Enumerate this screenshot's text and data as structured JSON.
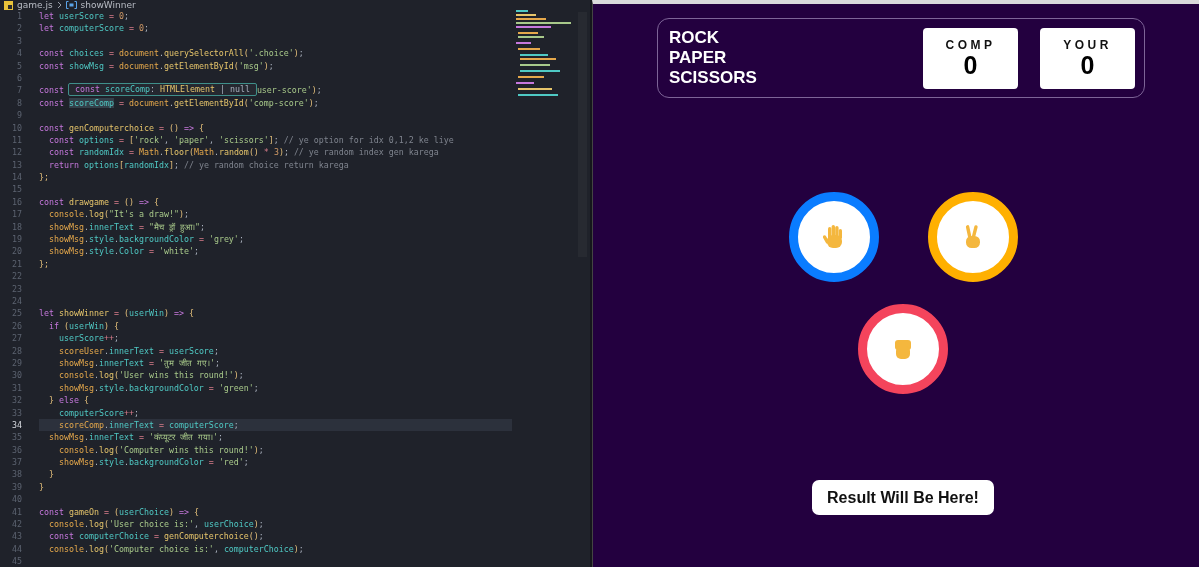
{
  "editor": {
    "breadcrumb": {
      "file": "game.js",
      "symbol": "showWinner"
    },
    "lines": [
      {
        "number": "1",
        "current": false,
        "tokens": [
          {
            "kind": "keyword",
            "text": "let "
          },
          {
            "kind": "variable",
            "text": "userScore"
          },
          {
            "kind": "operator",
            "text": " = "
          },
          {
            "kind": "number",
            "text": "0"
          },
          {
            "kind": "punct",
            "text": ";"
          }
        ]
      },
      {
        "number": "2",
        "current": false,
        "tokens": [
          {
            "kind": "keyword",
            "text": "let "
          },
          {
            "kind": "variable",
            "text": "computerScore"
          },
          {
            "kind": "operator",
            "text": " = "
          },
          {
            "kind": "number",
            "text": "0"
          },
          {
            "kind": "punct",
            "text": ";"
          }
        ]
      },
      {
        "number": "3",
        "current": false
      },
      {
        "number": "4",
        "current": false,
        "tokens": [
          {
            "kind": "keyword",
            "text": "const "
          },
          {
            "kind": "variable",
            "text": "choices"
          },
          {
            "kind": "operator",
            "text": " = "
          },
          {
            "kind": "object",
            "text": "document"
          },
          {
            "kind": "punct",
            "text": "."
          },
          {
            "kind": "function",
            "text": "querySelectorAll"
          },
          {
            "kind": "bracket",
            "text": "("
          },
          {
            "kind": "string",
            "text": "'.choice'"
          },
          {
            "kind": "bracket",
            "text": ")"
          },
          {
            "kind": "punct",
            "text": ";"
          }
        ]
      },
      {
        "number": "5",
        "current": false,
        "tokens": [
          {
            "kind": "keyword",
            "text": "const "
          },
          {
            "kind": "variable",
            "text": "showMsg"
          },
          {
            "kind": "operator",
            "text": " = "
          },
          {
            "kind": "object",
            "text": "document"
          },
          {
            "kind": "punct",
            "text": "."
          },
          {
            "kind": "function",
            "text": "getElementById"
          },
          {
            "kind": "bracket",
            "text": "("
          },
          {
            "kind": "string",
            "text": "'msg'"
          },
          {
            "kind": "bracket",
            "text": ")"
          },
          {
            "kind": "punct",
            "text": ";"
          }
        ]
      },
      {
        "number": "6",
        "current": false
      },
      {
        "number": "7",
        "current": false,
        "tokens": [
          {
            "kind": "keyword",
            "text": "const"
          }
        ],
        "tooltip": [
          {
            "kind": "keyword",
            "text": "const "
          },
          {
            "kind": "variable",
            "text": "scoreComp"
          },
          {
            "kind": "punct",
            "text": ": "
          },
          {
            "kind": "function",
            "text": "HTMLElement"
          },
          {
            "kind": "punct",
            "text": " | "
          },
          {
            "kind": "punct",
            "text": "null"
          }
        ],
        "after": [
          {
            "kind": "string",
            "text": "user-score'"
          },
          {
            "kind": "bracket",
            "text": ")"
          },
          {
            "kind": "punct",
            "text": ";"
          }
        ]
      },
      {
        "number": "8",
        "current": false,
        "tokens": [
          {
            "kind": "keyword",
            "text": "const "
          },
          {
            "kind": "highlight",
            "text": "scoreComp"
          },
          {
            "kind": "operator",
            "text": " = "
          },
          {
            "kind": "object",
            "text": "document"
          },
          {
            "kind": "punct",
            "text": "."
          },
          {
            "kind": "function",
            "text": "getElementById"
          },
          {
            "kind": "bracket",
            "text": "("
          },
          {
            "kind": "string",
            "text": "'comp-score'"
          },
          {
            "kind": "bracket",
            "text": ")"
          },
          {
            "kind": "punct",
            "text": ";"
          }
        ]
      },
      {
        "number": "9",
        "current": false
      },
      {
        "number": "10",
        "current": false,
        "tokens": [
          {
            "kind": "keyword",
            "text": "const "
          },
          {
            "kind": "function",
            "text": "genComputerchoice"
          },
          {
            "kind": "operator",
            "text": " = "
          },
          {
            "kind": "bracket",
            "text": "() "
          },
          {
            "kind": "keyword",
            "text": "=> "
          },
          {
            "kind": "bracket",
            "text": "{"
          }
        ]
      },
      {
        "number": "11",
        "current": false,
        "tokens": [
          {
            "kind": "keyword",
            "text": "  const "
          },
          {
            "kind": "variable",
            "text": "options"
          },
          {
            "kind": "operator",
            "text": " = "
          },
          {
            "kind": "bracket",
            "text": "["
          },
          {
            "kind": "string",
            "text": "'rock'"
          },
          {
            "kind": "punct",
            "text": ", "
          },
          {
            "kind": "string",
            "text": "'paper'"
          },
          {
            "kind": "punct",
            "text": ", "
          },
          {
            "kind": "string",
            "text": "'scissors'"
          },
          {
            "kind": "bracket",
            "text": "]"
          },
          {
            "kind": "punct",
            "text": "; "
          },
          {
            "kind": "comment",
            "text": "// ye option for idx 0,1,2 ke liye"
          }
        ]
      },
      {
        "number": "12",
        "current": false,
        "tokens": [
          {
            "kind": "keyword",
            "text": "  const "
          },
          {
            "kind": "variable",
            "text": "randomIdx"
          },
          {
            "kind": "operator",
            "text": " = "
          },
          {
            "kind": "object",
            "text": "Math"
          },
          {
            "kind": "punct",
            "text": "."
          },
          {
            "kind": "function",
            "text": "floor"
          },
          {
            "kind": "bracket",
            "text": "("
          },
          {
            "kind": "object",
            "text": "Math"
          },
          {
            "kind": "punct",
            "text": "."
          },
          {
            "kind": "function",
            "text": "random"
          },
          {
            "kind": "bracket",
            "text": "()"
          },
          {
            "kind": "operator",
            "text": " * "
          },
          {
            "kind": "number",
            "text": "3"
          },
          {
            "kind": "bracket",
            "text": ")"
          },
          {
            "kind": "punct",
            "text": "; "
          },
          {
            "kind": "comment",
            "text": "// ye random index gen karega"
          }
        ]
      },
      {
        "number": "13",
        "current": false,
        "tokens": [
          {
            "kind": "keyword",
            "text": "  return "
          },
          {
            "kind": "variable",
            "text": "options"
          },
          {
            "kind": "bracket",
            "text": "["
          },
          {
            "kind": "variable",
            "text": "randomIdx"
          },
          {
            "kind": "bracket",
            "text": "]"
          },
          {
            "kind": "punct",
            "text": "; "
          },
          {
            "kind": "comment",
            "text": "// ye random choice return karega"
          }
        ]
      },
      {
        "number": "14",
        "current": false,
        "tokens": [
          {
            "kind": "bracket",
            "text": "};"
          }
        ]
      },
      {
        "number": "15",
        "current": false
      },
      {
        "number": "16",
        "current": false,
        "tokens": [
          {
            "kind": "keyword",
            "text": "const "
          },
          {
            "kind": "function",
            "text": "drawgame"
          },
          {
            "kind": "operator",
            "text": " = "
          },
          {
            "kind": "bracket",
            "text": "() "
          },
          {
            "kind": "keyword",
            "text": "=> "
          },
          {
            "kind": "bracket",
            "text": "{"
          }
        ]
      },
      {
        "number": "17",
        "current": false,
        "tokens": [
          {
            "kind": "object",
            "text": "  console"
          },
          {
            "kind": "punct",
            "text": "."
          },
          {
            "kind": "function",
            "text": "log"
          },
          {
            "kind": "bracket",
            "text": "("
          },
          {
            "kind": "string",
            "text": "\"It's a draw!\""
          },
          {
            "kind": "bracket",
            "text": ")"
          },
          {
            "kind": "punct",
            "text": ";"
          }
        ]
      },
      {
        "number": "18",
        "current": false,
        "tokens": [
          {
            "kind": "object",
            "text": "  showMsg"
          },
          {
            "kind": "punct",
            "text": "."
          },
          {
            "kind": "variable",
            "text": "innerText"
          },
          {
            "kind": "operator",
            "text": " = "
          },
          {
            "kind": "string",
            "text": "\"मैच ड्रॉ हुआ।\""
          },
          {
            "kind": "punct",
            "text": ";"
          }
        ]
      },
      {
        "number": "19",
        "current": false,
        "tokens": [
          {
            "kind": "object",
            "text": "  showMsg"
          },
          {
            "kind": "punct",
            "text": "."
          },
          {
            "kind": "variable",
            "text": "style"
          },
          {
            "kind": "punct",
            "text": "."
          },
          {
            "kind": "variable",
            "text": "backgroundColor"
          },
          {
            "kind": "operator",
            "text": " = "
          },
          {
            "kind": "string",
            "text": "'grey'"
          },
          {
            "kind": "punct",
            "text": ";"
          }
        ]
      },
      {
        "number": "20",
        "current": false,
        "tokens": [
          {
            "kind": "object",
            "text": "  showMsg"
          },
          {
            "kind": "punct",
            "text": "."
          },
          {
            "kind": "variable",
            "text": "style"
          },
          {
            "kind": "punct",
            "text": "."
          },
          {
            "kind": "variable",
            "text": "Color"
          },
          {
            "kind": "operator",
            "text": " = "
          },
          {
            "kind": "string",
            "text": "'white'"
          },
          {
            "kind": "punct",
            "text": ";"
          }
        ]
      },
      {
        "number": "21",
        "current": false,
        "tokens": [
          {
            "kind": "bracket",
            "text": "};"
          }
        ]
      },
      {
        "number": "22",
        "current": false
      },
      {
        "number": "23",
        "current": false
      },
      {
        "number": "24",
        "current": false
      },
      {
        "number": "25",
        "current": false,
        "tokens": [
          {
            "kind": "keyword",
            "text": "let "
          },
          {
            "kind": "function",
            "text": "showWinner"
          },
          {
            "kind": "operator",
            "text": " = "
          },
          {
            "kind": "bracket",
            "text": "("
          },
          {
            "kind": "variable",
            "text": "userWin"
          },
          {
            "kind": "bracket",
            "text": ") "
          },
          {
            "kind": "keyword",
            "text": "=> "
          },
          {
            "kind": "bracket",
            "text": "{"
          }
        ]
      },
      {
        "number": "26",
        "current": false,
        "tokens": [
          {
            "kind": "keyword",
            "text": "  if "
          },
          {
            "kind": "bracket",
            "text": "("
          },
          {
            "kind": "variable",
            "text": "userWin"
          },
          {
            "kind": "bracket",
            "text": ") {"
          }
        ]
      },
      {
        "number": "27",
        "current": false,
        "tokens": [
          {
            "kind": "variable",
            "text": "    userScore"
          },
          {
            "kind": "operator",
            "text": "++"
          },
          {
            "kind": "punct",
            "text": ";"
          }
        ]
      },
      {
        "number": "28",
        "current": false,
        "tokens": [
          {
            "kind": "object",
            "text": "    scoreUser"
          },
          {
            "kind": "punct",
            "text": "."
          },
          {
            "kind": "variable",
            "text": "innerText"
          },
          {
            "kind": "operator",
            "text": " = "
          },
          {
            "kind": "variable",
            "text": "userScore"
          },
          {
            "kind": "punct",
            "text": ";"
          }
        ]
      },
      {
        "number": "29",
        "current": false,
        "tokens": [
          {
            "kind": "object",
            "text": "    showMsg"
          },
          {
            "kind": "punct",
            "text": "."
          },
          {
            "kind": "variable",
            "text": "innerText"
          },
          {
            "kind": "operator",
            "text": " = "
          },
          {
            "kind": "string",
            "text": "'तुम जीत गए।'"
          },
          {
            "kind": "punct",
            "text": ";"
          }
        ]
      },
      {
        "number": "30",
        "current": false,
        "tokens": [
          {
            "kind": "object",
            "text": "    console"
          },
          {
            "kind": "punct",
            "text": "."
          },
          {
            "kind": "function",
            "text": "log"
          },
          {
            "kind": "bracket",
            "text": "("
          },
          {
            "kind": "string",
            "text": "'User wins this round!'"
          },
          {
            "kind": "bracket",
            "text": ")"
          },
          {
            "kind": "punct",
            "text": ";"
          }
        ]
      },
      {
        "number": "31",
        "current": false,
        "tokens": [
          {
            "kind": "object",
            "text": "    showMsg"
          },
          {
            "kind": "punct",
            "text": "."
          },
          {
            "kind": "variable",
            "text": "style"
          },
          {
            "kind": "punct",
            "text": "."
          },
          {
            "kind": "variable",
            "text": "backgroundColor"
          },
          {
            "kind": "operator",
            "text": " = "
          },
          {
            "kind": "string",
            "text": "'green'"
          },
          {
            "kind": "punct",
            "text": ";"
          }
        ]
      },
      {
        "number": "32",
        "current": false,
        "tokens": [
          {
            "kind": "bracket",
            "text": "  } "
          },
          {
            "kind": "keyword",
            "text": "else "
          },
          {
            "kind": "bracket",
            "text": "{"
          }
        ]
      },
      {
        "number": "33",
        "current": false,
        "tokens": [
          {
            "kind": "variable",
            "text": "    computerScore"
          },
          {
            "kind": "operator",
            "text": "++"
          },
          {
            "kind": "punct",
            "text": ";"
          }
        ]
      },
      {
        "number": "34",
        "current": true,
        "tokens": [
          {
            "kind": "object",
            "text": "    scoreComp"
          },
          {
            "kind": "punct",
            "text": "."
          },
          {
            "kind": "variable",
            "text": "innerText"
          },
          {
            "kind": "operator",
            "text": " = "
          },
          {
            "kind": "variable",
            "text": "computerScore"
          },
          {
            "kind": "punct",
            "text": ";"
          }
        ]
      },
      {
        "number": "35",
        "current": false,
        "tokens": [
          {
            "kind": "object",
            "text": "  showMsg"
          },
          {
            "kind": "punct",
            "text": "."
          },
          {
            "kind": "variable",
            "text": "innerText"
          },
          {
            "kind": "operator",
            "text": " = "
          },
          {
            "kind": "string",
            "text": "'कंप्यूटर जीत गया।'"
          },
          {
            "kind": "punct",
            "text": ";"
          }
        ]
      },
      {
        "number": "36",
        "current": false,
        "tokens": [
          {
            "kind": "object",
            "text": "    console"
          },
          {
            "kind": "punct",
            "text": "."
          },
          {
            "kind": "function",
            "text": "log"
          },
          {
            "kind": "bracket",
            "text": "("
          },
          {
            "kind": "string",
            "text": "'Computer wins this round!'"
          },
          {
            "kind": "bracket",
            "text": ")"
          },
          {
            "kind": "punct",
            "text": ";"
          }
        ]
      },
      {
        "number": "37",
        "current": false,
        "tokens": [
          {
            "kind": "object",
            "text": "    showMsg"
          },
          {
            "kind": "punct",
            "text": "."
          },
          {
            "kind": "variable",
            "text": "style"
          },
          {
            "kind": "punct",
            "text": "."
          },
          {
            "kind": "variable",
            "text": "backgroundColor"
          },
          {
            "kind": "operator",
            "text": " = "
          },
          {
            "kind": "string",
            "text": "'red'"
          },
          {
            "kind": "punct",
            "text": ";"
          }
        ]
      },
      {
        "number": "38",
        "current": false,
        "tokens": [
          {
            "kind": "bracket",
            "text": "  }"
          }
        ]
      },
      {
        "number": "39",
        "current": false,
        "tokens": [
          {
            "kind": "bracket",
            "text": "}"
          }
        ]
      },
      {
        "number": "40",
        "current": false
      },
      {
        "number": "41",
        "current": false,
        "tokens": [
          {
            "kind": "keyword",
            "text": "const "
          },
          {
            "kind": "function",
            "text": "gameOn"
          },
          {
            "kind": "operator",
            "text": " = "
          },
          {
            "kind": "bracket",
            "text": "("
          },
          {
            "kind": "variable",
            "text": "userChoice"
          },
          {
            "kind": "bracket",
            "text": ") "
          },
          {
            "kind": "keyword",
            "text": "=> "
          },
          {
            "kind": "bracket",
            "text": "{"
          }
        ]
      },
      {
        "number": "42",
        "current": false,
        "tokens": [
          {
            "kind": "object",
            "text": "  console"
          },
          {
            "kind": "punct",
            "text": "."
          },
          {
            "kind": "function",
            "text": "log"
          },
          {
            "kind": "bracket",
            "text": "("
          },
          {
            "kind": "string",
            "text": "'User choice is:'"
          },
          {
            "kind": "punct",
            "text": ", "
          },
          {
            "kind": "variable",
            "text": "userChoice"
          },
          {
            "kind": "bracket",
            "text": ")"
          },
          {
            "kind": "punct",
            "text": ";"
          }
        ]
      },
      {
        "number": "43",
        "current": false,
        "tokens": [
          {
            "kind": "keyword",
            "text": "  const "
          },
          {
            "kind": "variable",
            "text": "computerChoice"
          },
          {
            "kind": "operator",
            "text": " = "
          },
          {
            "kind": "function",
            "text": "genComputerchoice"
          },
          {
            "kind": "bracket",
            "text": "()"
          },
          {
            "kind": "punct",
            "text": ";"
          }
        ]
      },
      {
        "number": "44",
        "current": false,
        "tokens": [
          {
            "kind": "object",
            "text": "  console"
          },
          {
            "kind": "punct",
            "text": "."
          },
          {
            "kind": "function",
            "text": "log"
          },
          {
            "kind": "bracket",
            "text": "("
          },
          {
            "kind": "string",
            "text": "'Computer choice is:'"
          },
          {
            "kind": "punct",
            "text": ", "
          },
          {
            "kind": "variable",
            "text": "computerChoice"
          },
          {
            "kind": "bracket",
            "text": ")"
          },
          {
            "kind": "punct",
            "text": ";"
          }
        ]
      },
      {
        "number": "45",
        "current": false
      }
    ]
  },
  "game": {
    "title": "ROCK PAPER SCISSORS",
    "scores": [
      {
        "label": "COMP",
        "value": "0"
      },
      {
        "label": "YOUR",
        "value": "0"
      }
    ],
    "choices": [
      {
        "kind": "paper",
        "color": "#0a7cff"
      },
      {
        "kind": "scissors",
        "color": "#ffb000"
      },
      {
        "kind": "rock",
        "color": "#f4445c"
      }
    ],
    "result": "Result Will Be Here!"
  }
}
